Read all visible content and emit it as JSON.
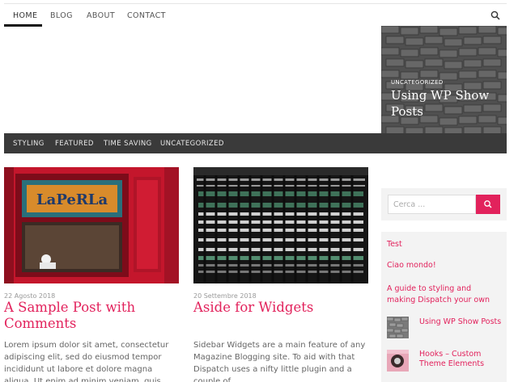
{
  "nav": {
    "items": [
      {
        "label": "HOME"
      },
      {
        "label": "BLOG"
      },
      {
        "label": "ABOUT"
      },
      {
        "label": "CONTACT"
      }
    ],
    "search_icon": "search-icon"
  },
  "hero": {
    "category": "UNCATEGORIZED",
    "title": "Using WP Show Posts"
  },
  "categories": [
    {
      "label": "STYLING"
    },
    {
      "label": "FEATURED"
    },
    {
      "label": "TIME SAVING"
    },
    {
      "label": "UNCATEGORIZED"
    }
  ],
  "posts": [
    {
      "date": "22 Agosto 2018",
      "title": "A Sample Post with Comments",
      "excerpt": "Lorem ipsum dolor sit amet, consectetur adipiscing elit, sed do eiusmod tempor incididunt ut labore et dolore magna aliqua. Ut enim ad minim veniam, quis"
    },
    {
      "date": "20 Settembre 2018",
      "title": "Aside for Widgets",
      "excerpt": "Sidebar Widgets are a main feature of any Magazine Blogging site. To aid with that Dispatch uses a nifty little plugin and a couple of"
    }
  ],
  "sidebar": {
    "search_placeholder": "Cerca ...",
    "links": [
      {
        "label": "Test"
      },
      {
        "label": "Ciao mondo!"
      },
      {
        "label": "A guide to styling and making Dispatch your own"
      }
    ],
    "thumb_posts": [
      {
        "title": "Using WP Show Posts"
      },
      {
        "title": "Hooks – Custom Theme Elements"
      }
    ]
  },
  "colors": {
    "accent": "#e2225c",
    "category_bar": "#3a3a3a",
    "sidebar_bg": "#f3f3f3"
  }
}
